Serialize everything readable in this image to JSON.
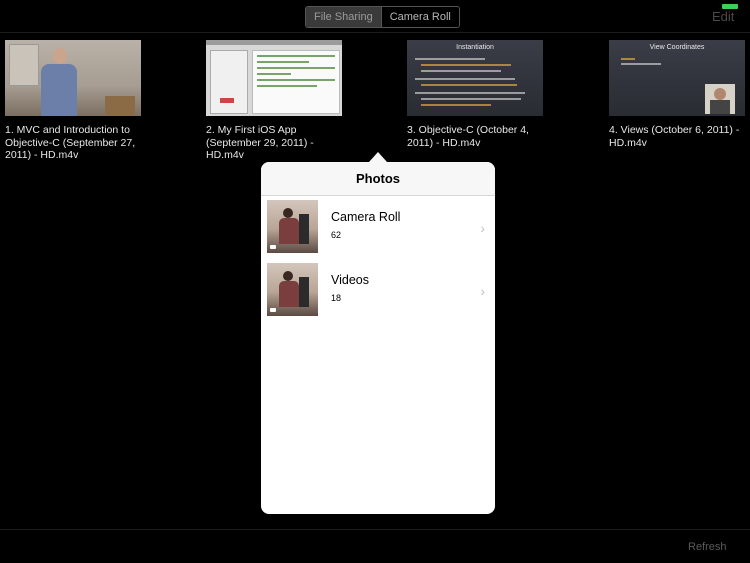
{
  "toolbar": {
    "segments": [
      "File Sharing",
      "Camera Roll"
    ],
    "selected_segment": "File Sharing",
    "edit_label": "Edit",
    "status_color": "#39d15a"
  },
  "videos": [
    {
      "caption": "1. MVC and Introduction to Objective-C (September 27, 2011) - HD.m4v"
    },
    {
      "caption": "2. My First iOS App (September 29, 2011) - HD.m4v"
    },
    {
      "caption": "3. Objective-C (October 4, 2011) - HD.m4v",
      "slide_title": "Instantiation"
    },
    {
      "caption": "4. Views (October 6, 2011) - HD.m4v",
      "slide_title": "View Coordinates"
    }
  ],
  "popover": {
    "title": "Photos",
    "albums": [
      {
        "name": "Camera Roll",
        "count": "62"
      },
      {
        "name": "Videos",
        "count": "18"
      }
    ]
  },
  "bottom": {
    "refresh_label": "Refresh"
  }
}
